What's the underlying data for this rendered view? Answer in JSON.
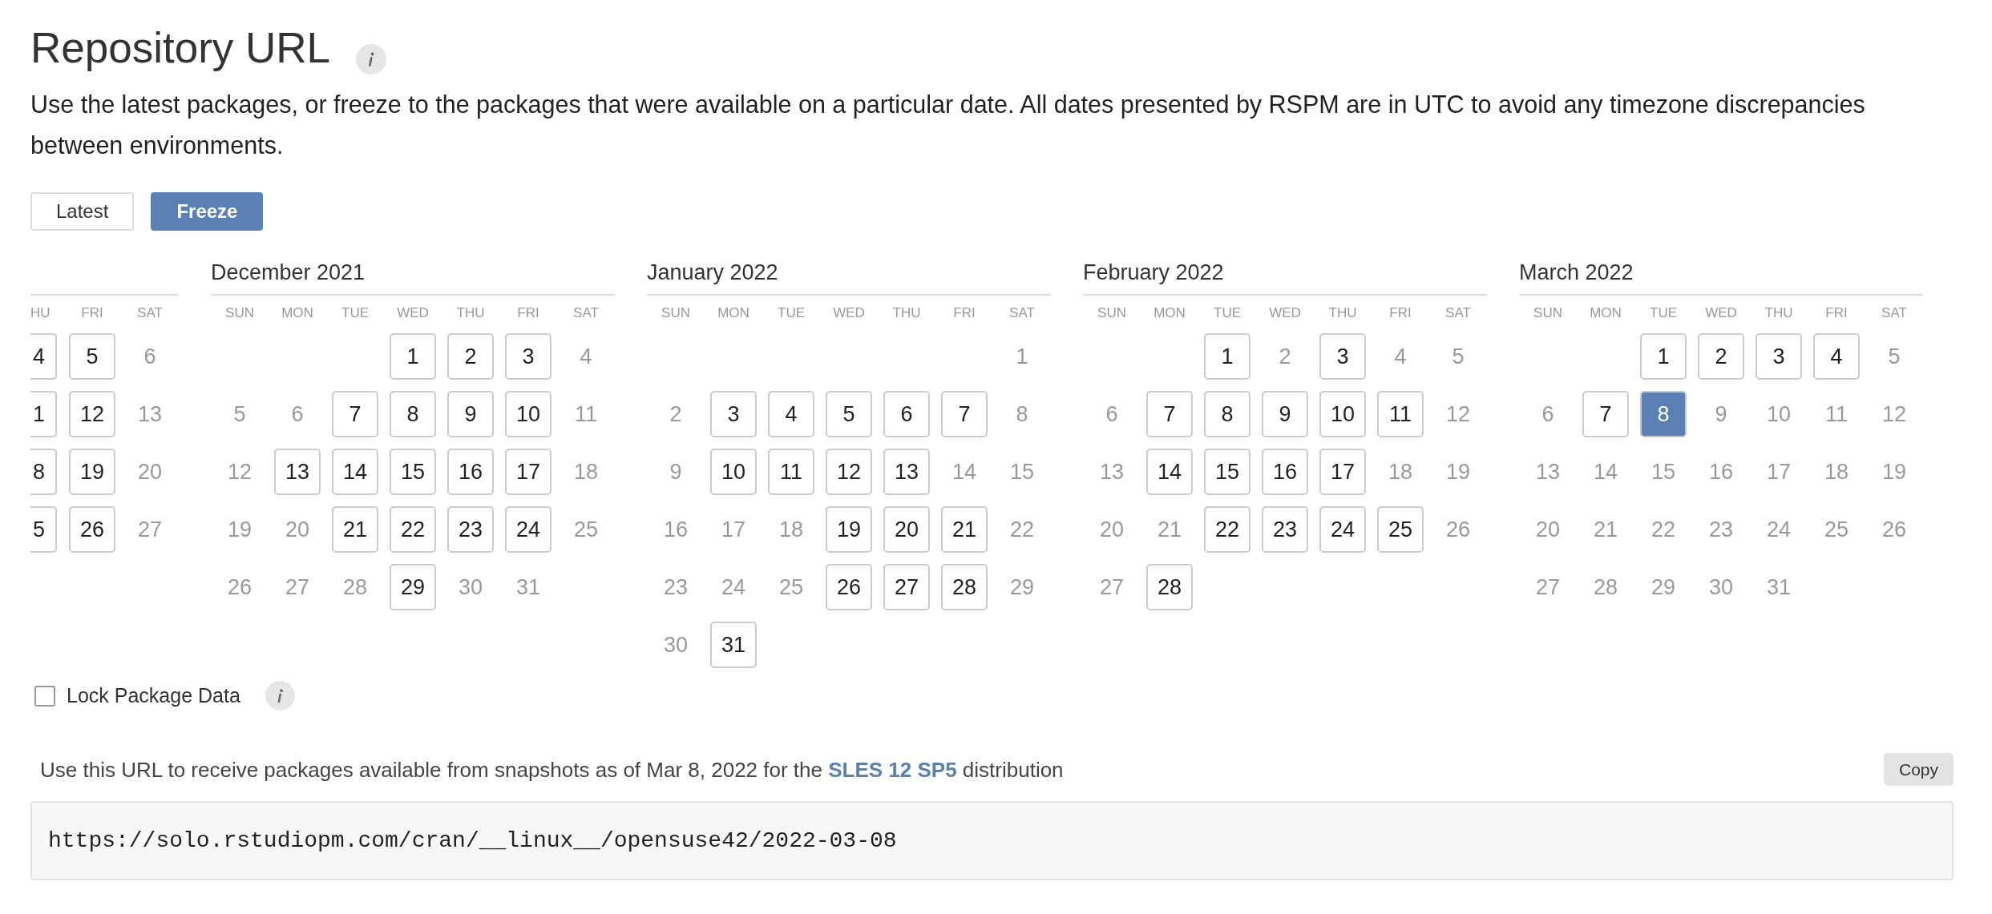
{
  "title": "Repository URL",
  "description": "Use the latest packages, or freeze to the packages that were available on a particular date. All dates presented by RSPM are in UTC to avoid any timezone discrepancies between environments.",
  "mode_buttons": [
    {
      "label": "Latest",
      "selected": false
    },
    {
      "label": "Freeze",
      "selected": true
    }
  ],
  "calendars": [
    {
      "kind": "clipped",
      "weekdays": [
        "HU",
        "FRI",
        "SAT"
      ],
      "weeks": [
        [
          {
            "day": "4",
            "available": true,
            "selected": false
          },
          {
            "day": "5",
            "available": true,
            "selected": false
          },
          {
            "day": "6",
            "available": false,
            "selected": false
          }
        ],
        [
          {
            "day": "1",
            "available": true,
            "selected": false
          },
          {
            "day": "12",
            "available": true,
            "selected": false
          },
          {
            "day": "13",
            "available": false,
            "selected": false
          }
        ],
        [
          {
            "day": "8",
            "available": true,
            "selected": false
          },
          {
            "day": "19",
            "available": true,
            "selected": false
          },
          {
            "day": "20",
            "available": false,
            "selected": false
          }
        ],
        [
          {
            "day": "5",
            "available": true,
            "selected": false
          },
          {
            "day": "26",
            "available": true,
            "selected": false
          },
          {
            "day": "27",
            "available": false,
            "selected": false
          }
        ]
      ]
    },
    {
      "kind": "full",
      "title": "December 2021",
      "weekdays": [
        "SUN",
        "MON",
        "TUE",
        "WED",
        "THU",
        "FRI",
        "SAT"
      ],
      "weeks": [
        [
          {
            "day": "1",
            "available": true,
            "selected": false
          },
          {
            "day": "2",
            "available": true,
            "selected": false
          },
          {
            "day": "3",
            "available": true,
            "selected": false
          },
          {
            "day": "4",
            "available": false,
            "selected": false
          }
        ],
        [
          {
            "day": "5",
            "available": false,
            "selected": false
          },
          {
            "day": "6",
            "available": false,
            "selected": false
          },
          {
            "day": "7",
            "available": true,
            "selected": false
          },
          {
            "day": "8",
            "available": true,
            "selected": false
          },
          {
            "day": "9",
            "available": true,
            "selected": false
          },
          {
            "day": "10",
            "available": true,
            "selected": false
          },
          {
            "day": "11",
            "available": false,
            "selected": false
          }
        ],
        [
          {
            "day": "12",
            "available": false,
            "selected": false
          },
          {
            "day": "13",
            "available": true,
            "selected": false
          },
          {
            "day": "14",
            "available": true,
            "selected": false
          },
          {
            "day": "15",
            "available": true,
            "selected": false
          },
          {
            "day": "16",
            "available": true,
            "selected": false
          },
          {
            "day": "17",
            "available": true,
            "selected": false
          },
          {
            "day": "18",
            "available": false,
            "selected": false
          }
        ],
        [
          {
            "day": "19",
            "available": false,
            "selected": false
          },
          {
            "day": "20",
            "available": false,
            "selected": false
          },
          {
            "day": "21",
            "available": true,
            "selected": false
          },
          {
            "day": "22",
            "available": true,
            "selected": false
          },
          {
            "day": "23",
            "available": true,
            "selected": false
          },
          {
            "day": "24",
            "available": true,
            "selected": false
          },
          {
            "day": "25",
            "available": false,
            "selected": false
          }
        ],
        [
          {
            "day": "26",
            "available": false,
            "selected": false
          },
          {
            "day": "27",
            "available": false,
            "selected": false
          },
          {
            "day": "28",
            "available": false,
            "selected": false
          },
          {
            "day": "29",
            "available": true,
            "selected": false
          },
          {
            "day": "30",
            "available": false,
            "selected": false
          },
          {
            "day": "31",
            "available": false,
            "selected": false
          }
        ]
      ]
    },
    {
      "kind": "full",
      "title": "January 2022",
      "weekdays": [
        "SUN",
        "MON",
        "TUE",
        "WED",
        "THU",
        "FRI",
        "SAT"
      ],
      "weeks": [
        [
          {
            "day": "1",
            "available": false,
            "selected": false
          }
        ],
        [
          {
            "day": "2",
            "available": false,
            "selected": false
          },
          {
            "day": "3",
            "available": true,
            "selected": false
          },
          {
            "day": "4",
            "available": true,
            "selected": false
          },
          {
            "day": "5",
            "available": true,
            "selected": false
          },
          {
            "day": "6",
            "available": true,
            "selected": false
          },
          {
            "day": "7",
            "available": true,
            "selected": false
          },
          {
            "day": "8",
            "available": false,
            "selected": false
          }
        ],
        [
          {
            "day": "9",
            "available": false,
            "selected": false
          },
          {
            "day": "10",
            "available": true,
            "selected": false
          },
          {
            "day": "11",
            "available": true,
            "selected": false
          },
          {
            "day": "12",
            "available": true,
            "selected": false
          },
          {
            "day": "13",
            "available": true,
            "selected": false
          },
          {
            "day": "14",
            "available": false,
            "selected": false
          },
          {
            "day": "15",
            "available": false,
            "selected": false
          }
        ],
        [
          {
            "day": "16",
            "available": false,
            "selected": false
          },
          {
            "day": "17",
            "available": false,
            "selected": false
          },
          {
            "day": "18",
            "available": false,
            "selected": false
          },
          {
            "day": "19",
            "available": true,
            "selected": false
          },
          {
            "day": "20",
            "available": true,
            "selected": false
          },
          {
            "day": "21",
            "available": true,
            "selected": false
          },
          {
            "day": "22",
            "available": false,
            "selected": false
          }
        ],
        [
          {
            "day": "23",
            "available": false,
            "selected": false
          },
          {
            "day": "24",
            "available": false,
            "selected": false
          },
          {
            "day": "25",
            "available": false,
            "selected": false
          },
          {
            "day": "26",
            "available": true,
            "selected": false
          },
          {
            "day": "27",
            "available": true,
            "selected": false
          },
          {
            "day": "28",
            "available": true,
            "selected": false
          },
          {
            "day": "29",
            "available": false,
            "selected": false
          }
        ],
        [
          {
            "day": "30",
            "available": false,
            "selected": false
          },
          {
            "day": "31",
            "available": true,
            "selected": false
          }
        ]
      ]
    },
    {
      "kind": "full",
      "title": "February 2022",
      "weekdays": [
        "SUN",
        "MON",
        "TUE",
        "WED",
        "THU",
        "FRI",
        "SAT"
      ],
      "weeks": [
        [
          {
            "day": "1",
            "available": true,
            "selected": false
          },
          {
            "day": "2",
            "available": false,
            "selected": false
          },
          {
            "day": "3",
            "available": true,
            "selected": false
          },
          {
            "day": "4",
            "available": false,
            "selected": false
          },
          {
            "day": "5",
            "available": false,
            "selected": false
          }
        ],
        [
          {
            "day": "6",
            "available": false,
            "selected": false
          },
          {
            "day": "7",
            "available": true,
            "selected": false
          },
          {
            "day": "8",
            "available": true,
            "selected": false
          },
          {
            "day": "9",
            "available": true,
            "selected": false
          },
          {
            "day": "10",
            "available": true,
            "selected": false
          },
          {
            "day": "11",
            "available": true,
            "selected": false
          },
          {
            "day": "12",
            "available": false,
            "selected": false
          }
        ],
        [
          {
            "day": "13",
            "available": false,
            "selected": false
          },
          {
            "day": "14",
            "available": true,
            "selected": false
          },
          {
            "day": "15",
            "available": true,
            "selected": false
          },
          {
            "day": "16",
            "available": true,
            "selected": false
          },
          {
            "day": "17",
            "available": true,
            "selected": false
          },
          {
            "day": "18",
            "available": false,
            "selected": false
          },
          {
            "day": "19",
            "available": false,
            "selected": false
          }
        ],
        [
          {
            "day": "20",
            "available": false,
            "selected": false
          },
          {
            "day": "21",
            "available": false,
            "selected": false
          },
          {
            "day": "22",
            "available": true,
            "selected": false
          },
          {
            "day": "23",
            "available": true,
            "selected": false
          },
          {
            "day": "24",
            "available": true,
            "selected": false
          },
          {
            "day": "25",
            "available": true,
            "selected": false
          },
          {
            "day": "26",
            "available": false,
            "selected": false
          }
        ],
        [
          {
            "day": "27",
            "available": false,
            "selected": false
          },
          {
            "day": "28",
            "available": true,
            "selected": false
          }
        ]
      ]
    },
    {
      "kind": "full",
      "title": "March 2022",
      "weekdays": [
        "SUN",
        "MON",
        "TUE",
        "WED",
        "THU",
        "FRI",
        "SAT"
      ],
      "weeks": [
        [
          {
            "day": "1",
            "available": true,
            "selected": false
          },
          {
            "day": "2",
            "available": true,
            "selected": false
          },
          {
            "day": "3",
            "available": true,
            "selected": false
          },
          {
            "day": "4",
            "available": true,
            "selected": false
          },
          {
            "day": "5",
            "available": false,
            "selected": false
          }
        ],
        [
          {
            "day": "6",
            "available": false,
            "selected": false
          },
          {
            "day": "7",
            "available": true,
            "selected": false
          },
          {
            "day": "8",
            "available": true,
            "selected": true
          },
          {
            "day": "9",
            "available": false,
            "selected": false
          },
          {
            "day": "10",
            "available": false,
            "selected": false
          },
          {
            "day": "11",
            "available": false,
            "selected": false
          },
          {
            "day": "12",
            "available": false,
            "selected": false
          }
        ],
        [
          {
            "day": "13",
            "available": false,
            "selected": false
          },
          {
            "day": "14",
            "available": false,
            "selected": false
          },
          {
            "day": "15",
            "available": false,
            "selected": false
          },
          {
            "day": "16",
            "available": false,
            "selected": false
          },
          {
            "day": "17",
            "available": false,
            "selected": false
          },
          {
            "day": "18",
            "available": false,
            "selected": false
          },
          {
            "day": "19",
            "available": false,
            "selected": false
          }
        ],
        [
          {
            "day": "20",
            "available": false,
            "selected": false
          },
          {
            "day": "21",
            "available": false,
            "selected": false
          },
          {
            "day": "22",
            "available": false,
            "selected": false
          },
          {
            "day": "23",
            "available": false,
            "selected": false
          },
          {
            "day": "24",
            "available": false,
            "selected": false
          },
          {
            "day": "25",
            "available": false,
            "selected": false
          },
          {
            "day": "26",
            "available": false,
            "selected": false
          }
        ],
        [
          {
            "day": "27",
            "available": false,
            "selected": false
          },
          {
            "day": "28",
            "available": false,
            "selected": false
          },
          {
            "day": "29",
            "available": false,
            "selected": false
          },
          {
            "day": "30",
            "available": false,
            "selected": false
          },
          {
            "day": "31",
            "available": false,
            "selected": false
          }
        ]
      ]
    }
  ],
  "lock": {
    "label": "Lock Package Data",
    "checked": false
  },
  "url_note": {
    "before": "Use this URL to receive packages available from snapshots as of Mar 8, 2022 for the",
    "link": "SLES 12 SP5",
    "after": "distribution"
  },
  "copy_button": "Copy",
  "url": "https://solo.rstudiopm.com/cran/__linux__/opensuse42/2022-03-08"
}
